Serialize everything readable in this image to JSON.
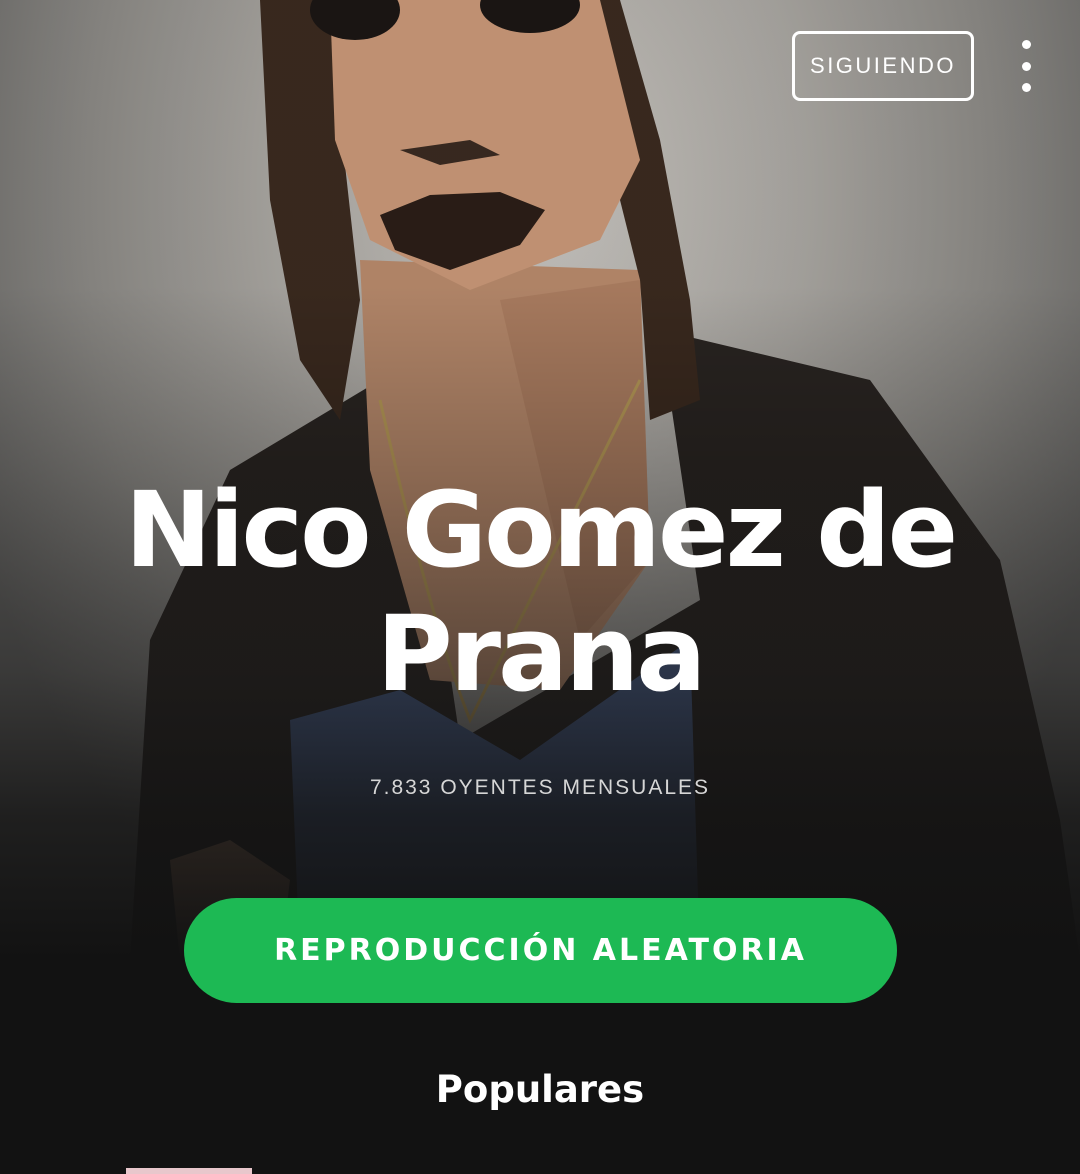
{
  "header": {
    "follow_label": "SIGUIENDO",
    "more_icon": "more-vertical-icon"
  },
  "artist": {
    "name": "Nico Gomez de Prana",
    "monthly_listeners": "7.833 OYENTES MENSUALES"
  },
  "actions": {
    "shuffle_label": "REPRODUCCIÓN ALEATORIA"
  },
  "sections": {
    "popular_title": "Populares"
  },
  "colors": {
    "accent": "#1db954",
    "background": "#121212",
    "text": "#ffffff"
  }
}
